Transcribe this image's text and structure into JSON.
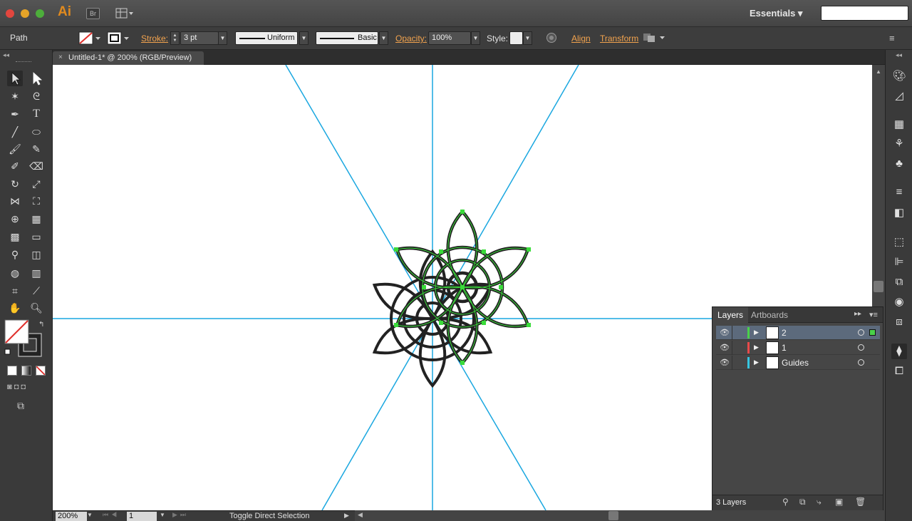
{
  "app": {
    "logo": "Ai",
    "bridge": "Br",
    "workspace": "Essentials ▾",
    "search_placeholder": ""
  },
  "control": {
    "selection_type": "Path",
    "stroke_label": "Stroke:",
    "stroke_weight": "3 pt",
    "profile": "Uniform",
    "brush": "Basic",
    "opacity_label": "Opacity:",
    "opacity": "100%",
    "style_label": "Style:",
    "align": "Align",
    "transform": "Transform"
  },
  "document": {
    "tab_title": "Untitled-1* @ 200% (RGB/Preview)",
    "close": "×"
  },
  "status": {
    "zoom": "200%",
    "artboard": "1",
    "message": "Toggle Direct Selection"
  },
  "layers_panel": {
    "tabs": [
      "Layers",
      "Artboards"
    ],
    "rows": [
      {
        "name": "2",
        "color": "#4ad14a",
        "selected": true
      },
      {
        "name": "1",
        "color": "#e84a4a",
        "selected": false
      },
      {
        "name": "Guides",
        "color": "#36c5e0",
        "selected": false
      }
    ],
    "count": "3 Layers"
  },
  "colors": {
    "guide": "#1aa7e0",
    "stroke": "#222222",
    "selection": "#3adb3a",
    "accent": "#f2a34e"
  }
}
